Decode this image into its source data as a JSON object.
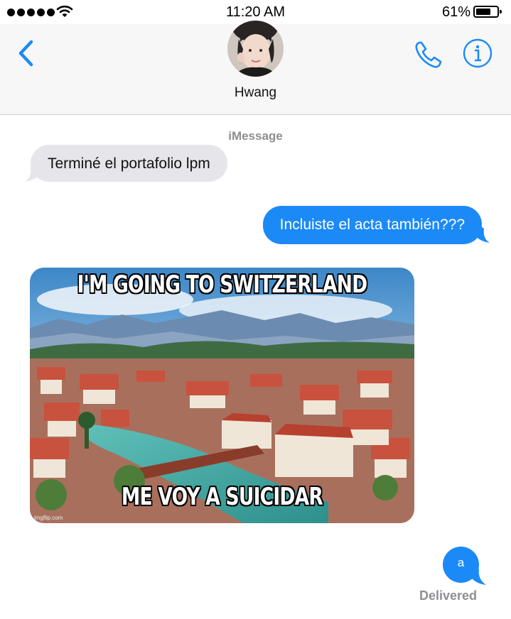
{
  "status_bar": {
    "time": "11:20 AM",
    "battery_percent": "61%",
    "battery_level": 0.61,
    "signal_bars": 5
  },
  "header": {
    "contact_name": "Hwang"
  },
  "conversation": {
    "service_label": "iMessage",
    "messages": [
      {
        "from": "them",
        "text": "Terminé el portafolio lpm"
      },
      {
        "from": "me",
        "text": "Incluiste el acta también???"
      },
      {
        "from": "them",
        "type": "image",
        "caption_top": "I'M GOING TO SWITZERLAND",
        "caption_bottom": "ME VOY A SUICIDAR",
        "watermark": "imgflip.com"
      },
      {
        "from": "me",
        "text": "a"
      }
    ],
    "delivery_status": "Delivered"
  },
  "colors": {
    "accent": "#1b8af7",
    "incoming_bubble": "#e5e5ea",
    "header_bg": "#f7f7f7",
    "secondary_text": "#8e8e93"
  },
  "icons": {
    "back": "chevron-left-icon",
    "call": "phone-icon",
    "info": "info-icon",
    "wifi": "wifi-icon",
    "battery": "battery-icon"
  }
}
